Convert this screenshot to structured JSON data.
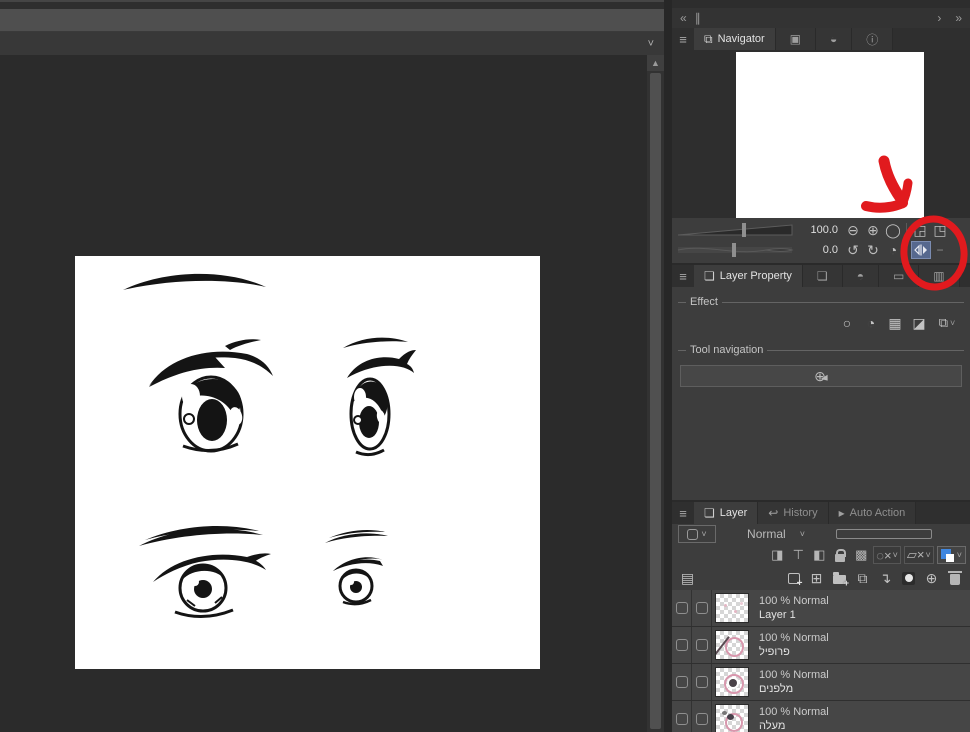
{
  "colors": {
    "annotation_red": "#e11a1e",
    "accent_blue": "#3f87e0",
    "flip_highlight": "#56688e"
  },
  "topbars": {
    "canvas_chevron": "˅",
    "scroll_up": "▲"
  },
  "panel_header": {
    "collapse_icon": "«",
    "split_icon": "∥",
    "arrow_icon": "›",
    "more_icon": "»"
  },
  "navigator": {
    "menu_icon": "≡",
    "tab_label": "Navigator",
    "tab_icon": "⧉",
    "side_tabs": [
      {
        "name": "subview-tab",
        "glyph": "▣"
      },
      {
        "name": "item-bank-tab",
        "glyph": "◒"
      },
      {
        "name": "information-tab",
        "glyph": "ⓘ"
      }
    ],
    "zoom_value": "100.0",
    "rotate_value": "0.0",
    "zoom_buttons": [
      {
        "name": "zoom-out",
        "glyph": "⊖"
      },
      {
        "name": "zoom-in",
        "glyph": "⊕"
      },
      {
        "name": "zoom-reset",
        "glyph": "◯"
      }
    ],
    "fit_buttons": [
      {
        "name": "fit-to-screen",
        "glyph": "◲"
      },
      {
        "name": "actual-size",
        "glyph": "◳"
      }
    ],
    "rotate_buttons": [
      {
        "name": "rotate-ccw",
        "glyph": "↺"
      },
      {
        "name": "rotate-cw",
        "glyph": "↻"
      },
      {
        "name": "rotate-reset",
        "glyph": "◔"
      }
    ],
    "edge_icon": "−"
  },
  "layer_property": {
    "menu_icon": "≡",
    "tab_label": "Layer Property",
    "tab_icon": "❏",
    "side_tabs": [
      {
        "name": "layer-search-tab",
        "glyph": "❏"
      },
      {
        "name": "tone-tab",
        "glyph": "◓"
      },
      {
        "name": "frame-tab",
        "glyph": "▭"
      },
      {
        "name": "animation-tab",
        "glyph": "▥"
      }
    ],
    "effect_label": "Effect",
    "effect_icons": [
      {
        "name": "border-effect",
        "glyph": "○"
      },
      {
        "name": "tone-effect",
        "glyph": "◔"
      },
      {
        "name": "halftone",
        "glyph": "▦"
      },
      {
        "name": "extract-line",
        "glyph": "◪"
      }
    ],
    "expression_color_icon": "⧉",
    "dropdown_chevron": "˅",
    "tool_navigation_label": "Tool navigation",
    "tool_navigation_icon": "⊕"
  },
  "layer_panel": {
    "menu_icon": "≡",
    "tabs": [
      {
        "name": "tab-layer",
        "label": "Layer",
        "glyph": "❏",
        "active": true
      },
      {
        "name": "tab-history",
        "label": "History",
        "glyph": "↩",
        "active": false
      },
      {
        "name": "tab-auto-action",
        "label": "Auto Action",
        "glyph": "▸",
        "active": false
      }
    ],
    "blend_mode": "Normal",
    "blend_chevron": "˅",
    "tool_icons": [
      {
        "name": "clip-to-layer-below",
        "glyph": "◨"
      },
      {
        "name": "enable-mask",
        "glyph": "⊤"
      },
      {
        "name": "set-as-draft",
        "glyph": "◧"
      },
      {
        "name": "lock-transparent-pixels",
        "glyph": "▩"
      }
    ],
    "reference_layer_icon": "◌×",
    "draft_layer_icon": "▱×",
    "palette_icon": "▤",
    "layers": [
      {
        "opacity_text": "100 % Normal",
        "name": "Layer 1",
        "doodle": "faint"
      },
      {
        "opacity_text": "100 % Normal",
        "name": "פרופיל",
        "doodle": "profile"
      },
      {
        "opacity_text": "100 % Normal",
        "name": "מלפנים",
        "doodle": "front"
      },
      {
        "opacity_text": "100 % Normal",
        "name": "מעלה",
        "doodle": "up"
      }
    ]
  }
}
